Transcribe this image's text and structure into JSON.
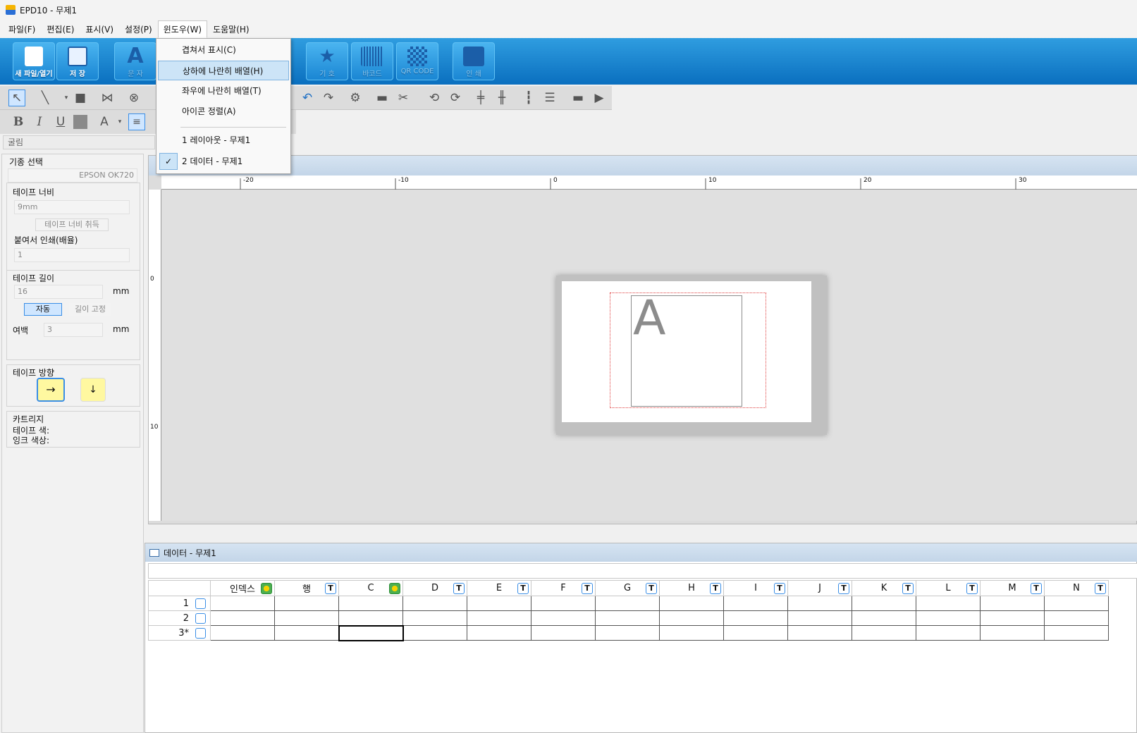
{
  "window": {
    "title": "EPD10 - 무제1"
  },
  "menubar": [
    "파일(F)",
    "편집(E)",
    "표시(V)",
    "설정(P)",
    "윈도우(W)",
    "도움말(H)"
  ],
  "ribbon": {
    "new_open": "새 파일/열기",
    "save": "저 장",
    "text": "문 자",
    "symbol": "기 호",
    "barcode": "바코드",
    "qrcode": "QR CODE",
    "print": "인 쇄"
  },
  "toolbar": {
    "font_name": "굴림"
  },
  "left_panel": {
    "model_label": "기종 선택",
    "model_value": "EPSON OK720",
    "tape_width_label": "테이프 너비",
    "tape_width_value": "9mm",
    "get_tape_width": "테이프 너비 취득",
    "copies_label": "붙여서 인쇄(배율)",
    "copies_value": "1",
    "tape_length_label": "테이프 길이",
    "tape_length_value": "16",
    "unit_mm": "mm",
    "auto": "자동",
    "fixed_length": "길이 고정",
    "margin_label": "여백",
    "margin_value": "3",
    "direction_label": "테이프 방향",
    "cartridge_label": "카트리지",
    "tape_color_label": "테이프 색:",
    "ink_color_label": "잉크 색상:"
  },
  "layout": {
    "ruler_labels": [
      "-20",
      "-10",
      "0",
      "10",
      "20",
      "30"
    ],
    "vruler_labels": [
      "0",
      "10"
    ],
    "label_text": "A"
  },
  "data_window": {
    "caption": "데이터  - 무제1",
    "columns": [
      {
        "name": "인덱스",
        "type": "o"
      },
      {
        "name": "행",
        "type": "T"
      },
      {
        "name": "C",
        "type": "o"
      },
      {
        "name": "D",
        "type": "T"
      },
      {
        "name": "E",
        "type": "T"
      },
      {
        "name": "F",
        "type": "T"
      },
      {
        "name": "G",
        "type": "T"
      },
      {
        "name": "H",
        "type": "T"
      },
      {
        "name": "I",
        "type": "T"
      },
      {
        "name": "J",
        "type": "T"
      },
      {
        "name": "K",
        "type": "T"
      },
      {
        "name": "L",
        "type": "T"
      },
      {
        "name": "M",
        "type": "T"
      },
      {
        "name": "N",
        "type": "T"
      }
    ],
    "rows": [
      "1",
      "2",
      "3*"
    ]
  },
  "window_menu": {
    "cascade": "겹쳐서 표시(C)",
    "tile_horizontal": "상하에 나란히 배열(H)",
    "tile_vertical": "좌우에 나란히 배열(T)",
    "arrange_icons": "아이콘 정렬(A)",
    "window1": "1 레이아웃  - 무제1",
    "window2": "2 데이터  - 무제1",
    "check": "✓"
  }
}
